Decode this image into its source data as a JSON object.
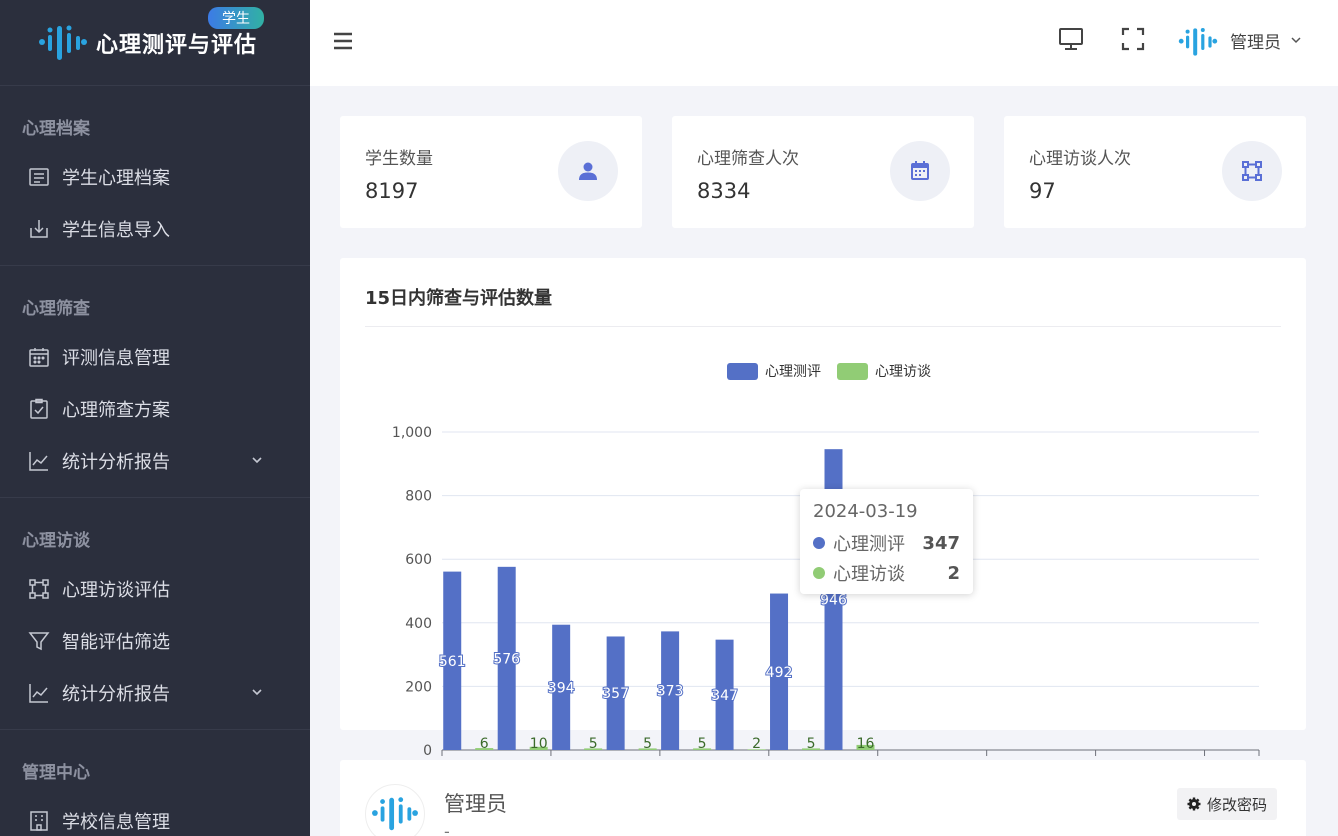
{
  "brand": {
    "title": "心理测评与评估",
    "badge": "学生"
  },
  "sidebar": {
    "groups": [
      {
        "title": "心理档案",
        "items": [
          {
            "label": "学生心理档案",
            "icon": "document-icon"
          },
          {
            "label": "学生信息导入",
            "icon": "import-icon"
          }
        ]
      },
      {
        "title": "心理筛查",
        "items": [
          {
            "label": "评测信息管理",
            "icon": "calendar-icon"
          },
          {
            "label": "心理筛查方案",
            "icon": "clipboard-check-icon"
          },
          {
            "label": "统计分析报告",
            "icon": "line-chart-icon",
            "expandable": true
          }
        ]
      },
      {
        "title": "心理访谈",
        "items": [
          {
            "label": "心理访谈评估",
            "icon": "nodes-icon"
          },
          {
            "label": "智能评估筛选",
            "icon": "filter-icon"
          },
          {
            "label": "统计分析报告",
            "icon": "line-chart-icon",
            "expandable": true
          }
        ]
      },
      {
        "title": "管理中心",
        "items": [
          {
            "label": "学校信息管理",
            "icon": "building-icon"
          }
        ]
      }
    ]
  },
  "header": {
    "user": "管理员"
  },
  "stats": [
    {
      "label": "学生数量",
      "value": "8197",
      "icon": "user-icon"
    },
    {
      "label": "心理筛查人次",
      "value": "8334",
      "icon": "calendar-icon"
    },
    {
      "label": "心理访谈人次",
      "value": "97",
      "icon": "nodes-icon"
    }
  ],
  "panel": {
    "title": "15日内筛查与评估数量"
  },
  "chart_data": {
    "type": "bar",
    "ylim": [
      0,
      1000
    ],
    "yticks": [
      0,
      200,
      400,
      600,
      800,
      1000
    ],
    "ytick_labels": [
      "0",
      "200",
      "400",
      "600",
      "800",
      "1,000"
    ],
    "category_count": 15,
    "legend_position": "top-center",
    "series": [
      {
        "name": "心理测评",
        "color": "#5470c6",
        "values": [
          561,
          576,
          394,
          357,
          373,
          347,
          492,
          946
        ]
      },
      {
        "name": "心理访谈",
        "color": "#91cc75",
        "values": [
          6,
          10,
          5,
          5,
          5,
          2,
          5,
          16
        ]
      }
    ]
  },
  "tooltip": {
    "date": "2024-03-19",
    "rows": [
      {
        "name": "心理测评",
        "value": "347",
        "color": "#5470c6"
      },
      {
        "name": "心理访谈",
        "value": "2",
        "color": "#91cc75"
      }
    ]
  },
  "user_card": {
    "name": "管理员",
    "sub": "-",
    "change_password": "修改密码"
  }
}
